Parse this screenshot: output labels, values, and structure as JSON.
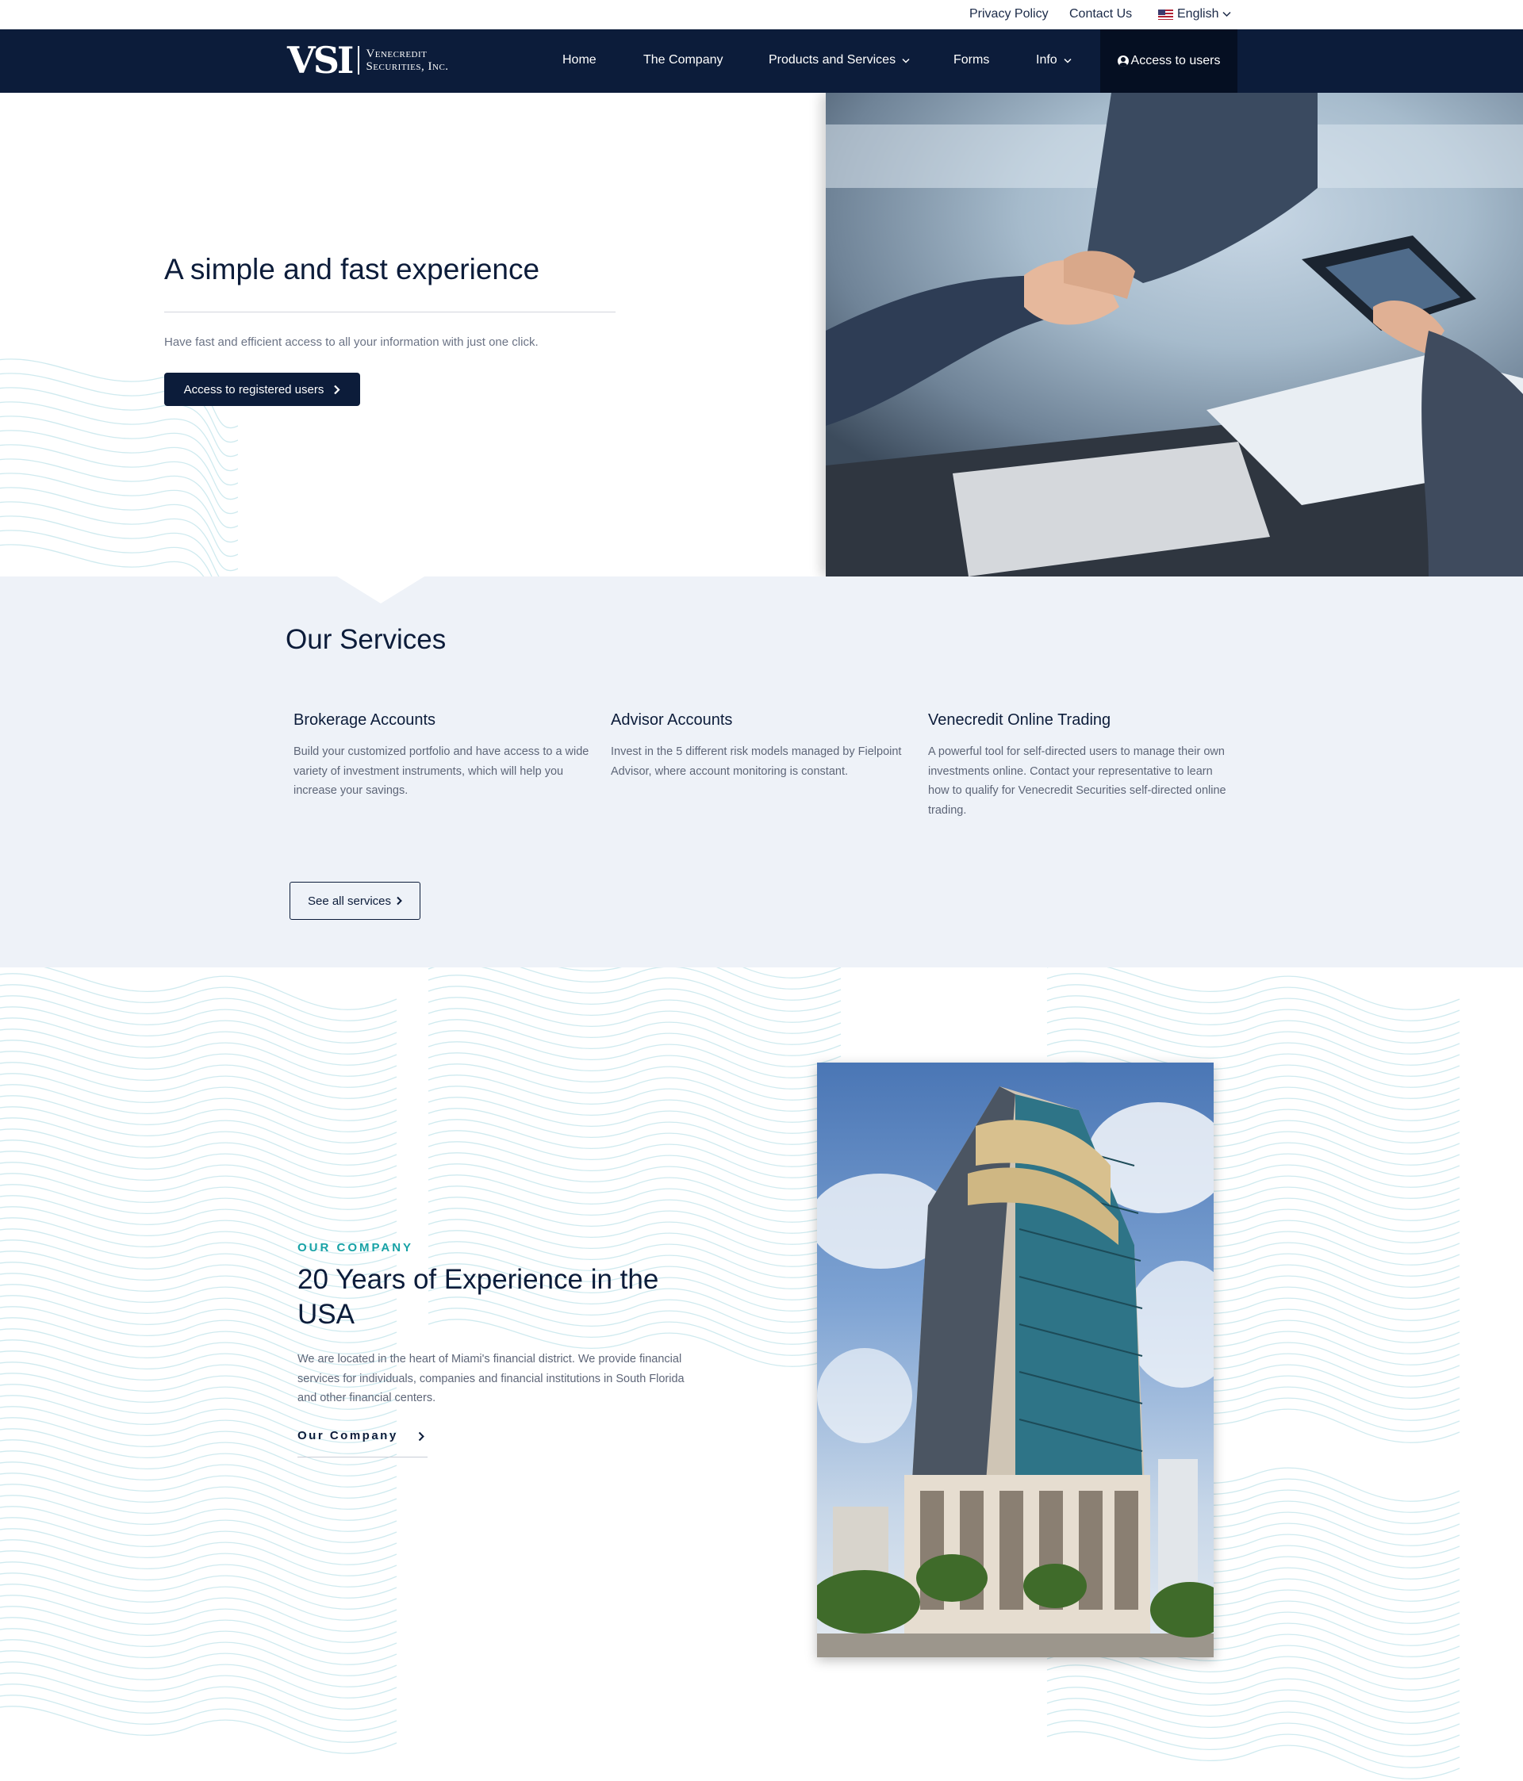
{
  "topbar": {
    "privacy": "Privacy Policy",
    "contact": "Contact Us",
    "language": "English"
  },
  "logo": {
    "mark": "VSI",
    "line1": "Venecredit",
    "line2": "Securities, Inc."
  },
  "nav": {
    "home": "Home",
    "company": "The Company",
    "products": "Products and Services",
    "forms": "Forms",
    "info": "Info",
    "access": "Access to users"
  },
  "hero": {
    "title": "A simple and fast experience",
    "text": "Have fast and efficient access to all your information with just one click.",
    "button": "Access to registered users"
  },
  "services": {
    "title": "Our Services",
    "items": [
      {
        "title": "Brokerage Accounts",
        "text": "Build your customized portfolio and have access to a wide variety of investment instruments, which will help you increase your savings."
      },
      {
        "title": "Advisor Accounts",
        "text": "Invest in the 5 different risk models managed by Fielpoint Advisor, where account monitoring is constant."
      },
      {
        "title": "Venecredit Online Trading",
        "text": "A powerful tool for self-directed users to manage their own investments online. Contact your representative to learn how to qualify for Venecredit Securities self-directed online trading."
      }
    ],
    "button": "See all services"
  },
  "company": {
    "eyebrow": "OUR COMPANY",
    "title": "20 Years of Experience in the USA",
    "text": "We are located in the heart of Miami's financial district. We provide financial services for individuals, companies and financial institutions in South Florida and other financial centers.",
    "link": "Our Company"
  },
  "colors": {
    "navy": "#0c1c3a",
    "teal": "#17a2a6",
    "services_bg": "#eef2f8",
    "wave_line": "#cfeaef"
  }
}
